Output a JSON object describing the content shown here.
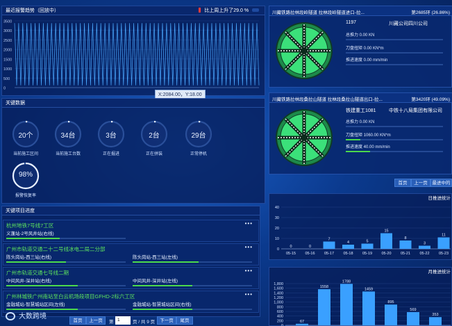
{
  "trend": {
    "title": "最近报警趋势（回放中）",
    "change_text": "比上周上升了29.0 %",
    "tooltip": "X:2084.00，Y:18.00",
    "y_ticks": [
      "3500",
      "3000",
      "2500",
      "2000",
      "1500",
      "1000",
      "500",
      "0"
    ]
  },
  "key_data": {
    "title": "关键数据",
    "gauges": [
      {
        "value": "20个",
        "label": "当前施工区间",
        "level": 0.02
      },
      {
        "value": "34台",
        "label": "当前施工台数",
        "level": 0.02
      },
      {
        "value": "3台",
        "label": "正在掘进",
        "level": 0.02
      },
      {
        "value": "2台",
        "label": "正在拼装",
        "level": 0.02
      },
      {
        "value": "29台",
        "label": "正常停机",
        "level": 0.02
      },
      {
        "value": "98%",
        "label": "报警恢复率",
        "level": 0.98
      }
    ]
  },
  "projects": {
    "title": "关键项目进度",
    "items": [
      {
        "name": "杭州地铁7号线7工区",
        "rows": [
          {
            "label": "义蓬站-2号风井站(右线)",
            "progress": 0.45
          }
        ]
      },
      {
        "name": "广州市轨道交通二十二号线冰电二局二分部",
        "rows": [
          {
            "label": "陈头岗站-西三站(右线)",
            "progress": 0.5
          },
          {
            "label": "陈头岗站-西三站(左线)",
            "progress": 0.55
          }
        ]
      },
      {
        "name": "广州市轨道交通七号线二期",
        "rows": [
          {
            "label": "中间风井-深井站(右线)",
            "progress": 0.6
          },
          {
            "label": "中间风井-深井站(左线)",
            "progress": 0.5
          }
        ]
      },
      {
        "name": "广州林城铁广州南站至白云机场段项目GFHD-2标六工区",
        "rows": [
          {
            "label": "金融城站-智慧城站区间(左线)",
            "progress": 0.6
          },
          {
            "label": "金融城站-智慧城站区间(右线)",
            "progress": 0.5
          }
        ]
      }
    ]
  },
  "pager": {
    "first": "首页",
    "prev": "上一页",
    "page_prefix": "第",
    "page_value": "1",
    "page_suffix": "页 / 共 9 页",
    "next": "下一页",
    "last": "尾页"
  },
  "logo_text": "大数跨境",
  "tbm": [
    {
      "title": "川藏铁路拉林段岭隧道 拉林段岭隧道进口-拉...",
      "ring": "第2685环 (26.86%)",
      "id": "1197",
      "company": "川藏公司四川公司",
      "thrust": "总推力 0.00 KN",
      "torque": "刀盘扭矩 0.00 KN*m",
      "speed": "推进速度 0.00 mm/min",
      "thrust_level": 0.0,
      "torque_level": 0.0,
      "speed_level": 0.0
    },
    {
      "title": "川藏铁路拉林段桑拉山隧道 拉林段桑拉山隧道出口-拉...",
      "ring": "第3420环 (49.09%)",
      "id": "铁建重工1081",
      "company": "中铁十八局集团有限公司",
      "thrust": "总推力 0.00 KN",
      "torque": "刀盘扭矩 1060.00 KN*m",
      "speed": "推进速度 40.00 mm/min",
      "thrust_level": 0.0,
      "torque_level": 0.15,
      "speed_level": 0.25
    }
  ],
  "right_pager": {
    "first": "首页",
    "prev": "上一页",
    "next": "最进中的"
  },
  "chart_data": [
    {
      "type": "line",
      "title": "最近报警趋势（回放中）",
      "ylim": [
        0,
        3500
      ],
      "y_ticks": [
        0,
        500,
        1000,
        1500,
        2000,
        2500,
        3000,
        3500
      ],
      "series": [
        {
          "values_pattern": "spikes up to about 3400 alternating with low values near 0"
        }
      ]
    },
    {
      "type": "bar",
      "title": "日推进统计",
      "categories": [
        "05-15",
        "05-16",
        "05-17",
        "05-18",
        "05-19",
        "05-20",
        "05-21",
        "05-22",
        "05-23"
      ],
      "values": [
        0,
        0,
        7,
        4,
        5,
        15,
        8,
        3,
        11
      ],
      "ylim": [
        0,
        40
      ],
      "y_ticks": [
        0,
        10,
        20,
        30,
        40
      ]
    },
    {
      "type": "bar",
      "title": "月推进统计",
      "values": [
        67,
        1558,
        1788,
        1459,
        895,
        569,
        353
      ],
      "ylim": [
        0,
        1800
      ],
      "y_ticks": [
        0,
        200,
        400,
        600,
        800,
        1000,
        1200,
        1400,
        1600,
        1800
      ]
    }
  ],
  "colors": {
    "accent_green": "#4cd94c",
    "bar_blue": "#3aa0ff",
    "panel_bg": "#061e5a",
    "alert_red": "#ff3b3b"
  }
}
